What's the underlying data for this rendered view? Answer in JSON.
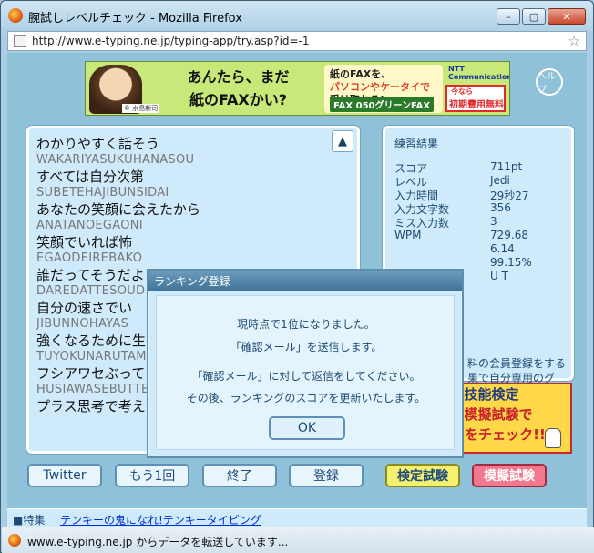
{
  "window": {
    "title": "腕試しレベルチェック - Mozilla Firefox",
    "minimize_glyph": "–",
    "maximize_glyph": "▢",
    "close_glyph": "✕"
  },
  "urlbar": {
    "url": "http://www.e-typing.ne.jp/typing-app/try.asp?id=-1"
  },
  "banner": {
    "main_line1": "あんたら、まだ",
    "main_line2": "紙のFAXかい?",
    "credit": "© 水島新司",
    "mid_line1": "紙のFAXを、",
    "mid_line2": "パソコンやケータイで",
    "mid_line3": "受け取れる!",
    "fax_label": "FAX 050グリーンFAX",
    "ntt": "NTT Communications",
    "promo_line1": "今なら",
    "promo_line2": "初期費用無料"
  },
  "help_label": "ヘルプ",
  "text_lines": [
    {
      "jp": "わかりやすく話そう",
      "romaji": "WAKARIYASUKUHANASOU"
    },
    {
      "jp": "すべては自分次第",
      "romaji": "SUBETEHAJIBUNSIDAI"
    },
    {
      "jp": "あなたの笑顔に会えたから",
      "romaji": "ANATANOEGAONI"
    },
    {
      "jp": "笑顔でいれば怖",
      "romaji": "EGAODEIREBAKO"
    },
    {
      "jp": "誰だってそうだよ",
      "romaji": "DAREDATTESOUD"
    },
    {
      "jp": "自分の速さでい",
      "romaji": "JIBUNNOHAYAS"
    },
    {
      "jp": "強くなるために生",
      "romaji": "TUYOKUNARUTAM"
    },
    {
      "jp": "フシアワセぶってる",
      "romaji": "HUSIAWASEBUTTERUDAKENANOCAMONE"
    },
    {
      "jp": "プラス思考で考えよう",
      "romaji": ""
    }
  ],
  "scroll": {
    "up": "▲",
    "down": "▼"
  },
  "results": {
    "title": "練習結果",
    "rows": [
      {
        "label": "スコア",
        "value": "711pt"
      },
      {
        "label": "レベル",
        "value": "Jedi"
      },
      {
        "label": "入力時間",
        "value": "29秒27"
      },
      {
        "label": "入力文字数",
        "value": "356"
      },
      {
        "label": "ミス入力数",
        "value": "3"
      },
      {
        "label": "WPM",
        "value": "729.68"
      },
      {
        "label": "",
        "value": "6.14"
      },
      {
        "label": "",
        "value": "99.15%"
      },
      {
        "label": "",
        "value": "U T"
      }
    ],
    "note": "料の会員登録をする果で自分専用のグラ。"
  },
  "promo": {
    "line1": "ング技能検定",
    "line2": "無料の模擬試験で",
    "line3": "今の実力をチェック!!"
  },
  "buttons": {
    "twitter": "Twitter",
    "again": "もう1回",
    "end": "終了",
    "register": "登録",
    "kentei": "検定試験",
    "mogi": "模擬試験"
  },
  "footer": {
    "tag": "■特集",
    "link": "テンキーの鬼になれ!テンキータイピング"
  },
  "status": {
    "text": "www.e-typing.ne.jp からデータを転送しています..."
  },
  "modal": {
    "title": "ランキング登録",
    "line1": "現時点で1位になりました。",
    "line2": "「確認メール」を送信します。",
    "line3": "「確認メール」に対して返信をしてください。",
    "line4": "その後、ランキングのスコアを更新いたします。",
    "ok": "OK"
  }
}
